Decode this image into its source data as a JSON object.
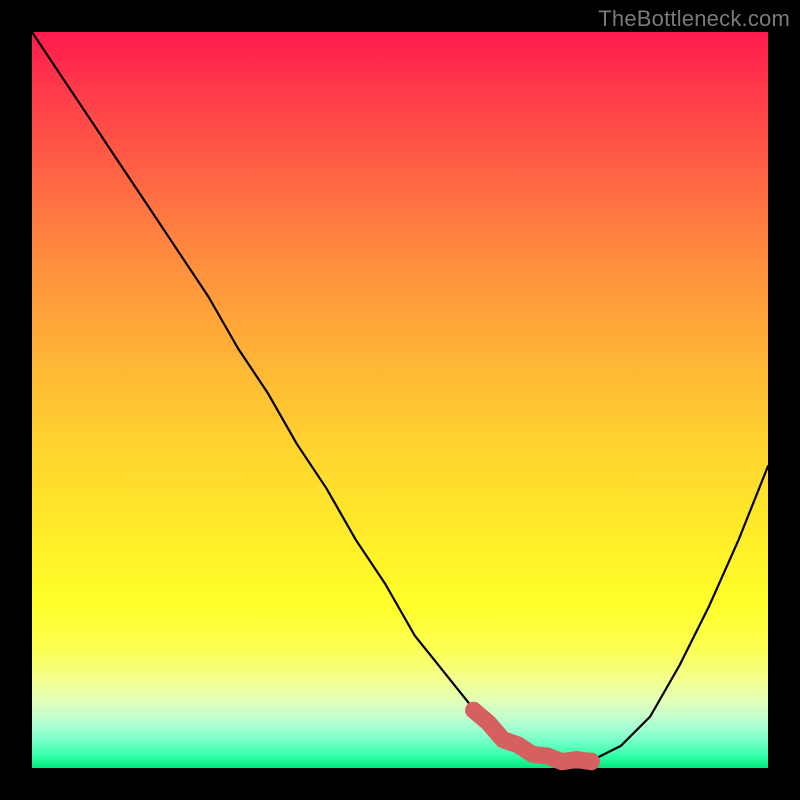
{
  "watermark": "TheBottleneck.com",
  "colors": {
    "black_frame": "#000000",
    "curve": "#000000",
    "emphasis": "#d66060"
  },
  "chart_data": {
    "type": "line",
    "title": "",
    "xlabel": "",
    "ylabel": "",
    "xlim": [
      0,
      100
    ],
    "ylim": [
      0,
      100
    ],
    "x": [
      0,
      4,
      8,
      12,
      16,
      20,
      24,
      28,
      32,
      36,
      40,
      44,
      48,
      52,
      56,
      60,
      64,
      68,
      72,
      76,
      80,
      84,
      88,
      92,
      96,
      100
    ],
    "values": [
      100,
      94,
      88,
      82,
      76,
      70,
      64,
      57,
      51,
      44,
      38,
      31,
      25,
      18,
      13,
      8,
      4,
      2,
      1,
      1,
      3,
      7,
      14,
      22,
      31,
      41
    ],
    "emphasis_range_x": [
      60,
      76
    ],
    "emphasis_dot_x": 76,
    "notes": "Gradient background from red (top) through orange/yellow to green (bottom). Axis values are relative percentages estimated from pixel positions; no tick labels shown."
  }
}
